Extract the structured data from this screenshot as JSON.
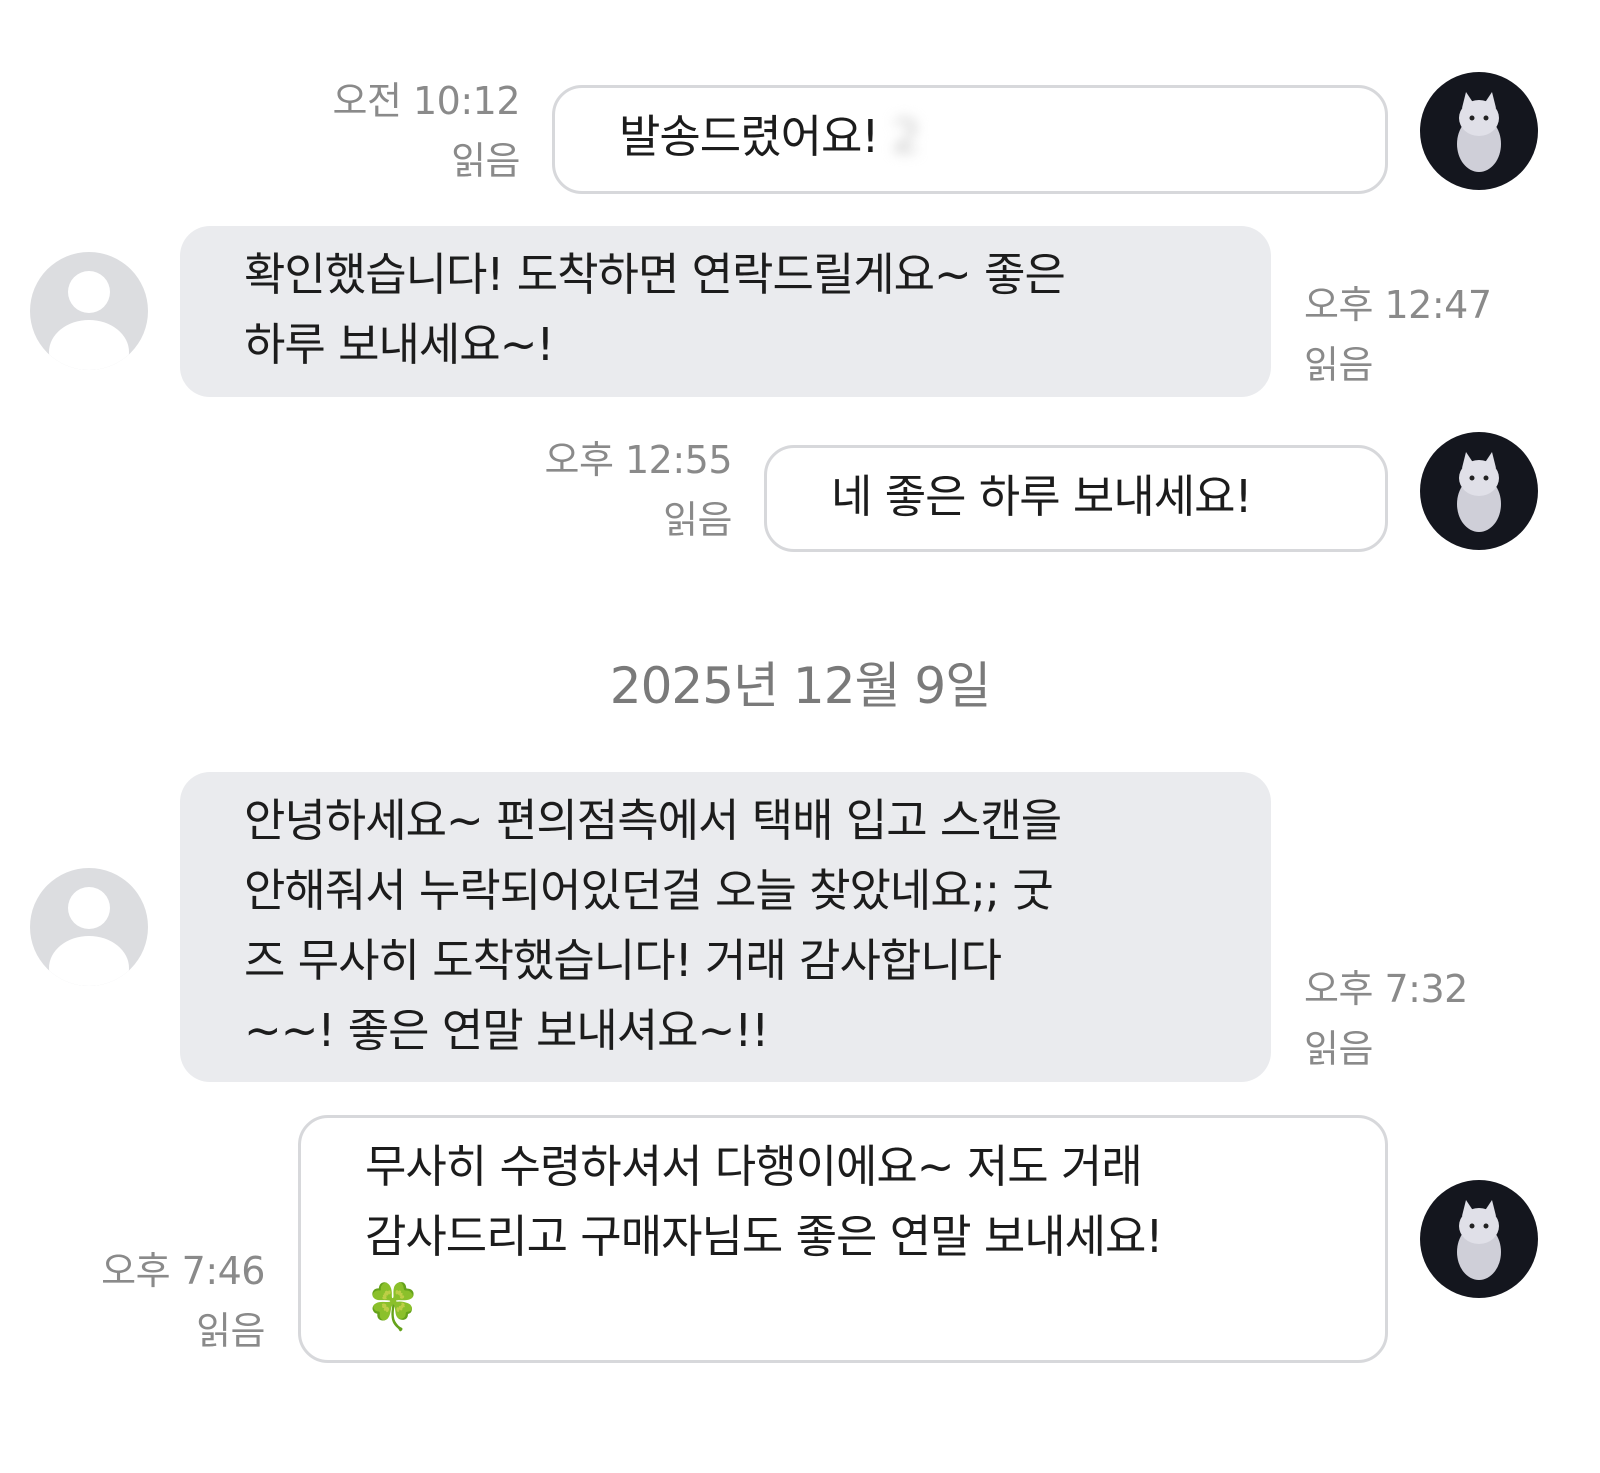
{
  "conversation": {
    "messages": [
      {
        "sender": "me",
        "time": "오전 10:12",
        "read": "읽음",
        "lines": [
          "발송드렸어요!"
        ],
        "redacted_text": "2"
      },
      {
        "sender": "other",
        "time": "오후 12:47",
        "read": "읽음",
        "lines": [
          "확인했습니다! 도착하면 연락드릴게요~ 좋은",
          "하루 보내세요~!"
        ]
      },
      {
        "sender": "me",
        "time": "오후 12:55",
        "read": "읽음",
        "lines": [
          "네 좋은 하루 보내세요!"
        ]
      },
      {
        "sender": "other",
        "time": "오후 7:32",
        "read": "읽음",
        "lines": [
          "안녕하세요~ 편의점측에서 택배 입고 스캔을",
          "안해줘서 누락되어있던걸 오늘 찾았네요;; 굿",
          "즈 무사히 도착했습니다! 거래 감사합니다",
          "~~! 좋은 연말 보내셔요~!!"
        ]
      },
      {
        "sender": "me",
        "time": "오후 7:46",
        "read": "읽음",
        "lines": [
          "무사히 수령하셔서 다행이에요~ 저도 거래",
          "감사드리고 구매자님도 좋은 연말 보내세요!",
          "🍀"
        ]
      }
    ],
    "date_separator": "2025년 12월 9일"
  },
  "icons": {
    "my_avatar": "cat-profile-avatar-icon",
    "other_avatar": "default-user-avatar-icon",
    "emoji": "four-leaf-clover-icon"
  },
  "colors": {
    "incoming_bubble": "#eaebee",
    "outgoing_bubble_border": "#d7d8db",
    "meta_text": "#8a8a8a"
  }
}
